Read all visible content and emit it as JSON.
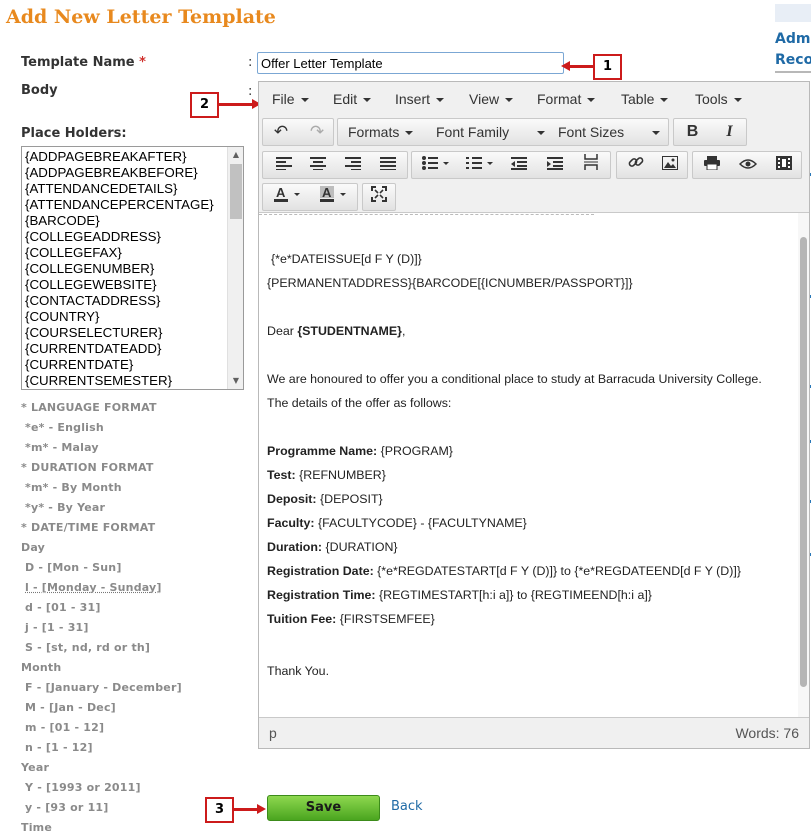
{
  "page": {
    "title": "Add New Letter Template"
  },
  "right_rail": {
    "links": [
      "Adm",
      "Reco"
    ]
  },
  "form": {
    "template_name_label": "Template Name",
    "required_mark": "*",
    "colon": ":",
    "template_name_value": "Offer Letter Template",
    "body_label": "Body",
    "placeholders_label": "Place Holders:"
  },
  "callouts": {
    "c1": "1",
    "c2": "2",
    "c3": "3"
  },
  "placeholders": [
    "{ADDPAGEBREAKAFTER}",
    "{ADDPAGEBREAKBEFORE}",
    "{ATTENDANCEDETAILS}",
    "{ATTENDANCEPERCENTAGE}",
    "{BARCODE}",
    "{COLLEGEADDRESS}",
    "{COLLEGEFAX}",
    "{COLLEGENUMBER}",
    "{COLLEGEWEBSITE}",
    "{CONTACTADDRESS}",
    "{COUNTRY}",
    "{COURSELECTURER}",
    "{CURRENTDATEADD}",
    "{CURRENTDATE}",
    "{CURRENTSEMESTER}"
  ],
  "format_help": [
    "* LANGUAGE FORMAT",
    "*e* - English",
    "*m* - Malay",
    "* DURATION FORMAT",
    "*m* - By Month",
    "*y* - By Year",
    "* DATE/TIME FORMAT",
    "Day",
    "D - [Mon - Sun]",
    "l - [Monday - Sunday]",
    "d - [01 - 31]",
    "j - [1 - 31]",
    "S - [st, nd, rd or th]",
    "Month",
    "F - [January - December]",
    "M - [Jan - Dec]",
    "m - [01 - 12]",
    "n - [1 - 12]",
    "Year",
    "Y - [1993 or 2011]",
    "y - [93 or 11]",
    "Time"
  ],
  "editor": {
    "menus": [
      "File",
      "Edit",
      "Insert",
      "View",
      "Format",
      "Table",
      "Tools"
    ],
    "dropdowns": {
      "formats": "Formats",
      "font_family": "Font Family",
      "font_sizes": "Font Sizes"
    },
    "bold": "B",
    "italic": "I",
    "status_path": "p",
    "word_count": "Words: 76",
    "content": {
      "line1": "{*e*DATEISSUE[d F Y (D)]}",
      "line2": "{PERMANENTADDRESS}{BARCODE[{ICNUMBER/PASSPORT}]}",
      "dear": "Dear ",
      "student": "{STUDENTNAME}",
      "dear_end": ",",
      "offer1": "We are honoured to offer you a conditional place to study at Barracuda University College.",
      "offer2": "The details of the offer as follows:",
      "fields": [
        {
          "label": "Programme Name:",
          "value": " {PROGRAM}"
        },
        {
          "label": "Test:",
          "value": " {REFNUMBER}"
        },
        {
          "label": "Deposit:",
          "value": " {DEPOSIT}"
        },
        {
          "label": "Faculty:",
          "value": " {FACULTYCODE} - {FACULTYNAME}"
        },
        {
          "label": "Duration:",
          "value": " {DURATION}"
        },
        {
          "label": "Registration Date:",
          "value": " {*e*REGDATESTART[d F Y (D)]} to {*e*REGDATEEND[d F Y (D)]}"
        },
        {
          "label": "Registration Time:",
          "value": " {REGTIMESTART[h:i a]} to {REGTIMEEND[h:i a]}"
        },
        {
          "label": "Tuition Fee:",
          "value": " {FIRSTSEMFEE}"
        }
      ],
      "thanks": "Thank You."
    }
  },
  "actions": {
    "save": "Save",
    "back": "Back"
  },
  "colors": {
    "title": "#e8891e",
    "link": "#1f6aa6",
    "callout": "#cc1b1b",
    "save": "#5cb82a"
  }
}
